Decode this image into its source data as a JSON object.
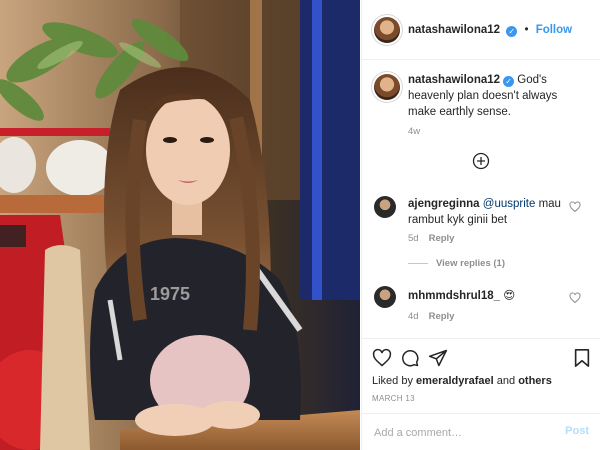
{
  "colors": {
    "accent": "#3897f0",
    "text": "#262626",
    "muted": "#8e8e8e",
    "border": "#efefef"
  },
  "post": {
    "author": {
      "username": "natashawilona12",
      "verified_icon": "verified-badge-icon"
    },
    "follow_separator": "•",
    "follow_label": "Follow",
    "caption": {
      "username": "natashawilona12",
      "text": "God's heavenly plan doesn't always make earthly sense.",
      "time": "4w"
    },
    "load_more_icon": "plus-circle-icon",
    "comments": [
      {
        "username": "ajengreginna",
        "mention": "@uusprite",
        "text": " mau rambut kyk ginii bet",
        "time": "5d",
        "reply_label": "Reply",
        "view_replies": "View replies (1)"
      },
      {
        "username": "mhmmdshrul18_",
        "text": "😍",
        "time": "4d",
        "reply_label": "Reply"
      }
    ],
    "actions": [
      "heart-icon",
      "comment-icon",
      "share-icon",
      "bookmark-icon"
    ],
    "likes": {
      "prefix": "Liked by",
      "user": "emeraldyrafael",
      "conj": "and",
      "others": "others"
    },
    "date": "MARCH 13",
    "add_comment": {
      "placeholder": "Add a comment…",
      "post_label": "Post"
    }
  }
}
